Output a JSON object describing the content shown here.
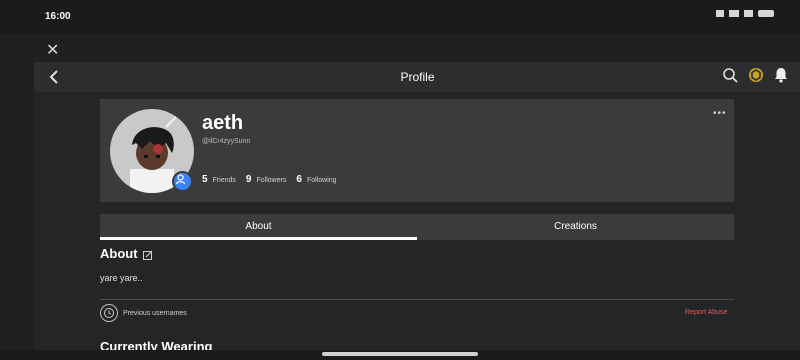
{
  "status": {
    "time": "16:00"
  },
  "nav": {
    "title": "Profile"
  },
  "profile": {
    "username": "aeth",
    "handle": "@ilCr4zyySunn",
    "friends_count": "5",
    "friends_label": "Friends",
    "followers_count": "9",
    "followers_label": "Followers",
    "following_count": "6",
    "following_label": "Following",
    "more": "•••"
  },
  "tabs": [
    {
      "label": "About",
      "active": true
    },
    {
      "label": "Creations",
      "active": false
    }
  ],
  "about": {
    "title": "About",
    "text": "yare yare..",
    "previous_usernames_label": "Previous usernames",
    "report_label": "Report Abuse"
  },
  "section": {
    "currently_wearing": "Currently Wearing"
  },
  "icons": {
    "close": "close-icon",
    "back": "back-arrow-icon",
    "search": "search-icon",
    "currency": "robux-icon",
    "notifications": "bell-icon",
    "edit": "edit-icon",
    "history": "history-icon"
  },
  "colors": {
    "background": "#232527",
    "card": "#393b3d",
    "report": "#e15b5b",
    "badge": "#3b82f6"
  }
}
